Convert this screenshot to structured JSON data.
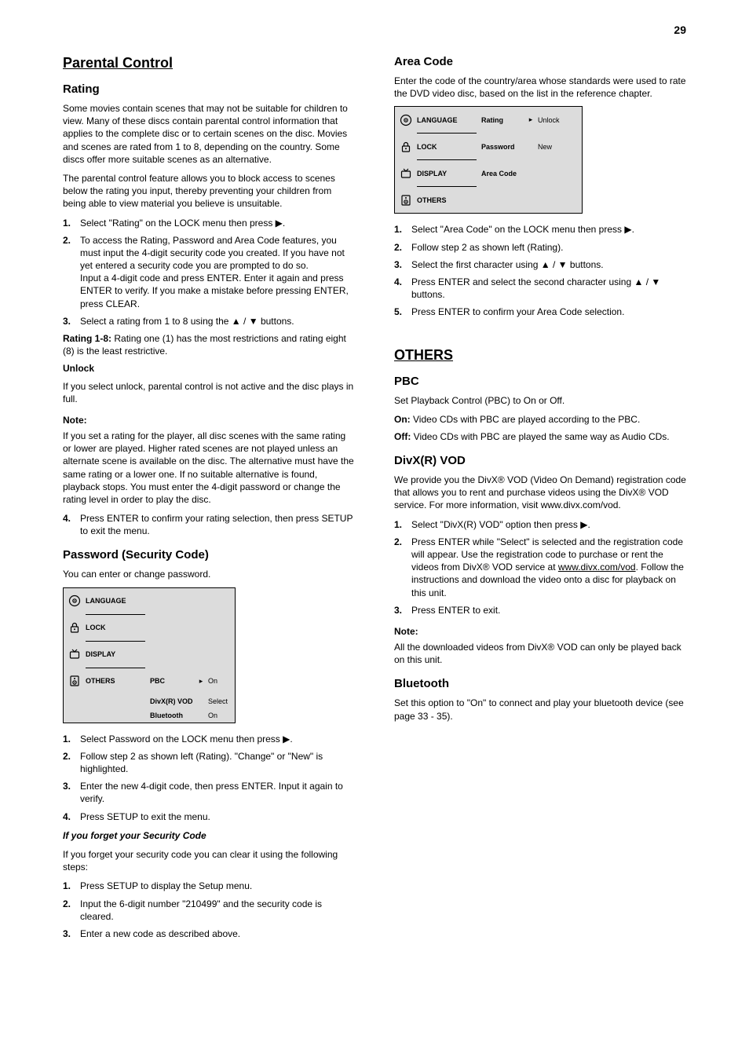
{
  "page_number": "29",
  "glyphs": {
    "up": "▲",
    "down": "▼",
    "left": "◀",
    "right": "▶",
    "small_right": "▸",
    "bullet": "•"
  },
  "left": {
    "title": "Parental Control",
    "rating_title": "Rating",
    "rating_p1": "Some movies contain scenes that may not be suitable for children to view. Many of these discs contain parental control information that applies to the complete disc or to certain scenes on the disc. Movies and scenes are rated from 1 to 8, depending on the country. Some discs offer more suitable scenes as an alternative.",
    "rating_p2": "The parental control feature allows you to block access to scenes below the rating you input, thereby preventing your children from being able to view material you believe is unsuitable.",
    "step1": {
      "a": "Select \"Rating\" on the LOCK menu then press ",
      "b": "."
    },
    "step2": {
      "a": "To access the Rating, Password and Area Code features, you must input the 4-digit security code you created. If you have not yet entered a security code you are prompted to do so.",
      "b": "Input a 4-digit code and press ENTER. Enter it again and press ENTER to verify. If you make a mistake before pressing ENTER, press CLEAR."
    },
    "step3": {
      "a": "Select a rating from 1 to 8 using the ",
      "b": " buttons."
    },
    "rating_label": "Rating 1-8:",
    "rating_desc": "Rating one (1) has the most restrictions and rating eight (8) is the least restrictive.",
    "unlock_label": "Unlock",
    "unlock_desc": "If you select unlock, parental control is not active and the disc plays in full.",
    "note_head": "Note:",
    "note_text": "If you set a rating for the player, all disc scenes with the same rating or lower are played. Higher rated scenes are not played unless an alternate scene is available on the disc. The alternative must have the same rating or a lower one. If no suitable alternative is found, playback stops. You must enter the 4-digit password or change the rating level in order to play the disc.",
    "step4": "Press ENTER to confirm your rating selection, then press SETUP to exit the menu.",
    "password_title": "Password (Security Code)",
    "password_sub": "You can enter or change password.",
    "pw_step1": {
      "a": "Select Password on the LOCK menu then press ",
      "b": "."
    },
    "pw_step2": "Follow step 2 as shown left (Rating). \"Change\" or \"New\" is highlighted.",
    "pw_step3": "Enter the new 4-digit code, then press ENTER. Input it again to verify.",
    "pw_step4": "Press SETUP to exit the menu.",
    "forgot_sub": "If you forget your Security Code",
    "forgot_intro": "If you forget your security code you can clear it using the following steps:",
    "forgot_1": "Press SETUP to display the Setup menu.",
    "forgot_2": "Input the 6-digit number \"210499\" and the security code is cleared.",
    "forgot_3": "Enter a new code as described above."
  },
  "right": {
    "area_title": "Area Code",
    "area_p1": "Enter the code of the country/area whose standards were used to rate the DVD video disc, based on the list in the reference chapter.",
    "area_step1": {
      "a": "Select \"Area Code\" on the LOCK menu then press ",
      "b": "."
    },
    "area_step2": "Follow step 2 as shown left (Rating).",
    "area_step3": {
      "a": "Select the first character using ",
      "b": " buttons."
    },
    "area_step4": {
      "a": "Press ENTER and select the second character using ",
      "b": " buttons."
    },
    "area_step5": "Press ENTER to confirm your Area Code selection.",
    "others_title": "OTHERS",
    "pbc_label": "PBC",
    "pbc_desc": "Set Playback Control (PBC) to On or Off.",
    "pbc_on_label": "On:",
    "pbc_on_desc": "Video CDs with PBC are played according to the PBC.",
    "pbc_off_label": "Off:",
    "pbc_off_desc": "Video CDs with PBC are played the same way as Audio CDs.",
    "divx_label": "DivX(R) VOD",
    "divx_p1": "We provide you the DivX® VOD (Video On Demand) registration code that allows you to rent and purchase videos using the DivX® VOD service. For more information, visit www.divx.com/vod.",
    "divx_step1": "Select \"DivX(R) VOD\" option then press ▶.",
    "divx_step2": {
      "a": "Press ENTER while \"Select\" is selected and the registration code will appear. Use the registration code to purchase or rent the videos from DivX® VOD service at ",
      "b": "www.divx.com/vod",
      "c": ". Follow the instructions and download the video onto a disc for playback on this unit."
    },
    "divx_step3": "Press ENTER to exit.",
    "note_head": "Note:",
    "note_text": "All the downloaded videos from DivX® VOD can only be played back on this unit.",
    "bluetooth_label": "Bluetooth",
    "bluetooth_p": "Set this option to \"On\" to connect and play your bluetooth device (see page 33 - 35)."
  },
  "menu_items": {
    "language": "LANGUAGE",
    "lock": "LOCK",
    "display": "DISPLAY",
    "others": "OTHERS"
  },
  "menu_left": {
    "pbc": "PBC",
    "divx": "DivX(R) VOD",
    "bluetooth": "Bluetooth",
    "val_pbc": "On",
    "val_divx": "Select",
    "val_bt": "On"
  },
  "menu_right": {
    "rating": "Rating",
    "password": "Password",
    "area_code": "Area Code",
    "val_rating": "Unlock",
    "val_password": "New",
    "val_area": ""
  }
}
